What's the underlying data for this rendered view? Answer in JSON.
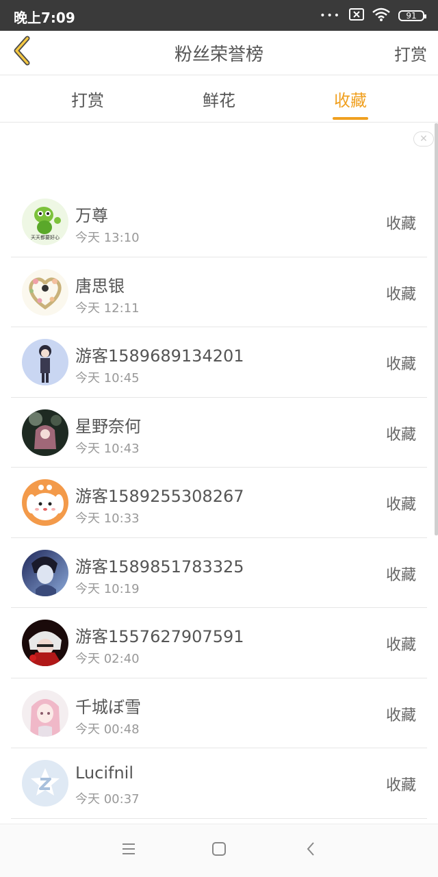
{
  "status": {
    "time": "晚上7:09",
    "battery": "91"
  },
  "header": {
    "title": "粉丝荣誉榜",
    "action": "打赏"
  },
  "tabs": [
    {
      "label": "打赏",
      "active": false
    },
    {
      "label": "鲜花",
      "active": false
    },
    {
      "label": "收藏",
      "active": true
    }
  ],
  "colors": {
    "accent": "#f0a020",
    "status_bar": "#3a3a3a"
  },
  "list": [
    {
      "name": "万尊",
      "time": "今天 13:10",
      "action": "收藏",
      "avatar": "green-mascot-avatar"
    },
    {
      "name": "唐思银",
      "time": "今天 12:11",
      "action": "收藏",
      "avatar": "flower-wreath-avatar"
    },
    {
      "name": "游客1589689134201",
      "time": "今天 10:45",
      "action": "收藏",
      "avatar": "anime-boy-avatar"
    },
    {
      "name": "星野奈何",
      "time": "今天 10:43",
      "action": "收藏",
      "avatar": "dark-anime-avatar"
    },
    {
      "name": "游客1589255308267",
      "time": "今天 10:33",
      "action": "收藏",
      "avatar": "cartoon-dog-avatar"
    },
    {
      "name": "游客1589851783325",
      "time": "今天 10:19",
      "action": "收藏",
      "avatar": "blue-portrait-avatar"
    },
    {
      "name": "游客1557627907591",
      "time": "今天 02:40",
      "action": "收藏",
      "avatar": "red-anime-avatar"
    },
    {
      "name": "千城ぼ雪",
      "time": "今天 00:48",
      "action": "收藏",
      "avatar": "pink-hair-avatar"
    },
    {
      "name": "Lucifnil",
      "time": "今天 00:37",
      "action": "收藏",
      "avatar": "default-qq-avatar"
    }
  ]
}
